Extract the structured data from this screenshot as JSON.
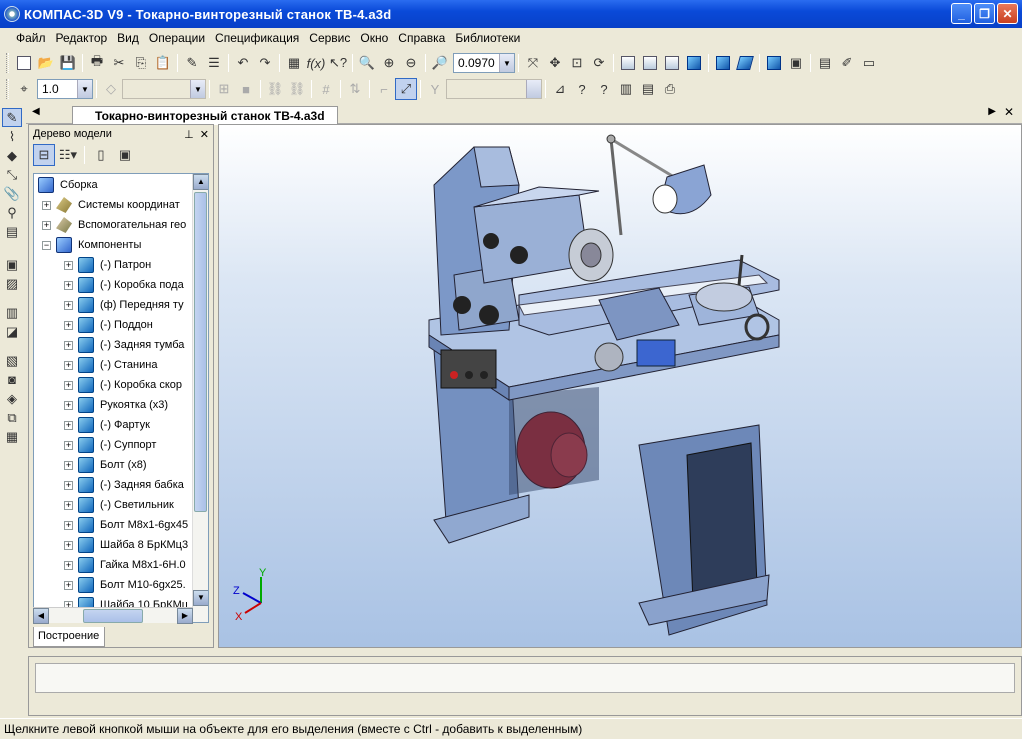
{
  "window": {
    "title": "КОМПАС-3D V9 - Токарно-винторезный станок ТВ-4.a3d"
  },
  "menu": [
    "Файл",
    "Редактор",
    "Вид",
    "Операции",
    "Спецификация",
    "Сервис",
    "Окно",
    "Справка",
    "Библиотеки"
  ],
  "toolbar": {
    "zoom_value": "0.0970",
    "step_value": "1.0"
  },
  "document_tab": {
    "label": "Токарно-винторезный станок ТВ-4.a3d"
  },
  "tree": {
    "header": "Дерево модели",
    "root": "Сборка",
    "groups": [
      "Системы координат",
      "Вспомогательная гео",
      "Компоненты"
    ],
    "components": [
      "(-) Патрон",
      "(-) Коробка пода",
      "(ф) Передняя ту",
      "(-) Поддон",
      "(-) Задняя тумба",
      "(-) Станина",
      "(-) Коробка скор",
      "Рукоятка (x3)",
      "(-) Фартук",
      "(-) Суппорт",
      "Болт (x8)",
      "(-) Задняя бабка",
      "(-) Светильник",
      "Болт М8х1-6gх45",
      "Шайба 8 БрКМц3",
      "Гайка  М8х1-6Н.0",
      "Болт М10-6gх25.",
      "Шайба 10 БрКМц"
    ],
    "bottom_tab": "Построение"
  },
  "axes": {
    "x": "X",
    "y": "Y",
    "z": "Z"
  },
  "status": {
    "text": "Щелкните левой кнопкой мыши на объекте для его выделения (вместе с Ctrl - добавить к выделенным)"
  }
}
